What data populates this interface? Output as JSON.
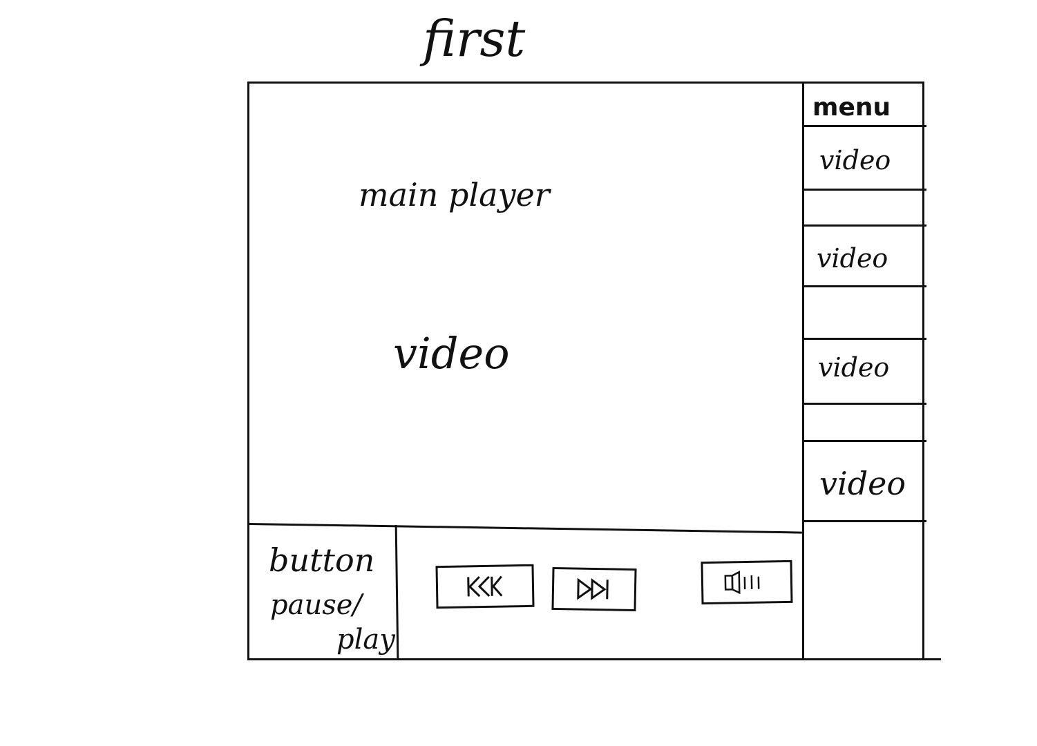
{
  "page": {
    "title": "first"
  },
  "player": {
    "label": "main player",
    "video_label": "video"
  },
  "sidebar": {
    "menu_label": "menu",
    "items": [
      {
        "label": "video"
      },
      {
        "label": "video"
      },
      {
        "label": "video"
      },
      {
        "label": "video"
      }
    ]
  },
  "controls": {
    "button_label": "button",
    "pause_label": "pause/",
    "play_label": "play",
    "icons": [
      "previous-icon",
      "next-icon",
      "volume-icon"
    ]
  }
}
